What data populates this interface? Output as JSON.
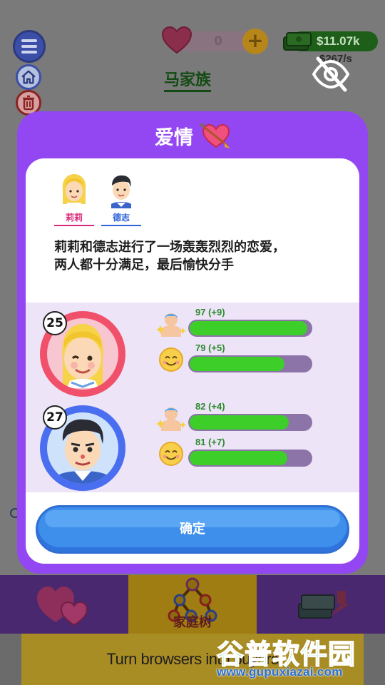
{
  "topbar": {
    "hearts_count": "0",
    "money": "$11.07k",
    "money_rate": "$267/s",
    "family_name": "马家族"
  },
  "modal": {
    "title": "爱情",
    "people": [
      {
        "name": "莉莉",
        "color": "#d8287a"
      },
      {
        "name": "德志",
        "color": "#2e62d9"
      }
    ],
    "story_line1": "莉莉和德志进行了一场轰轰烈烈的恋爱，",
    "story_line2": "两人都十分满足，最后愉快分手",
    "stats": [
      {
        "person": "莉莉",
        "age": "25",
        "health": {
          "label": "97 (+9)",
          "value": 97
        },
        "happiness": {
          "label": "79 (+5)",
          "value": 79
        }
      },
      {
        "person": "德志",
        "age": "27",
        "health": {
          "label": "82 (+4)",
          "value": 82
        },
        "happiness": {
          "label": "81 (+7)",
          "value": 81
        }
      }
    ],
    "confirm_label": "确定"
  },
  "tabbar": {
    "tabs": [
      {
        "label": "",
        "icon": "hearts-icon",
        "active": false
      },
      {
        "label": "家庭树",
        "icon": "family-tree-icon",
        "active": true
      },
      {
        "label": "",
        "icon": "money-stack-icon",
        "active": false
      }
    ]
  },
  "ad": {
    "text": "Turn browsers into buyers"
  },
  "watermark": {
    "title": "谷普软件园",
    "url": "www.gupuxiazai.com"
  },
  "colors": {
    "modal_purple": "#9347f2",
    "bar_fill": "#3dce2a",
    "bar_track": "#8c73a8",
    "confirm_blue": "#3e8fec",
    "lily_ring": "#f0506a",
    "dezhi_ring": "#4a6ef0"
  }
}
